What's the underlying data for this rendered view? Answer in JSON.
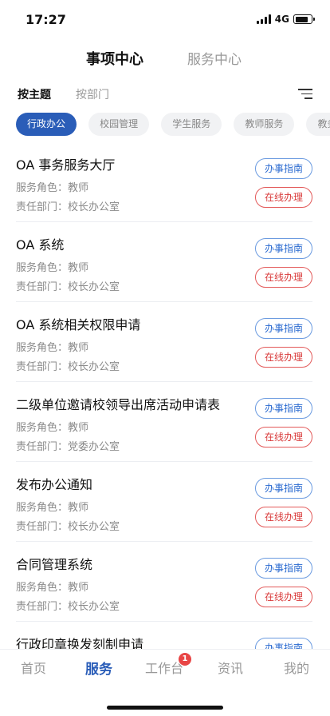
{
  "status_bar": {
    "time": "17:27",
    "network": "4G"
  },
  "top_tabs": {
    "active": "事项中心",
    "inactive": "服务中心"
  },
  "sub_tabs": {
    "active": "按主题",
    "inactive": "按部门"
  },
  "chips": [
    "行政办公",
    "校园管理",
    "学生服务",
    "教师服务",
    "教务"
  ],
  "items": [
    {
      "title": "OA 事务服务大厅",
      "role": "服务角色：教师",
      "dept": "责任部门：校长办公室"
    },
    {
      "title": "OA 系统",
      "role": "服务角色：教师",
      "dept": "责任部门：校长办公室"
    },
    {
      "title": "OA 系统相关权限申请",
      "role": "服务角色：教师",
      "dept": "责任部门：校长办公室"
    },
    {
      "title": "二级单位邀请校领导出席活动申请表",
      "role": "服务角色：教师",
      "dept": "责任部门：党委办公室"
    },
    {
      "title": "发布办公通知",
      "role": "服务角色：教师",
      "dept": "责任部门：校长办公室"
    },
    {
      "title": "合同管理系统",
      "role": "服务角色：教师",
      "dept": "责任部门：校长办公室"
    },
    {
      "title": "行政印章换发刻制申请",
      "role": "",
      "dept": ""
    }
  ],
  "buttons": {
    "guide": "办事指南",
    "online": "在线办理"
  },
  "tab_bar": {
    "home": "首页",
    "service": "服务",
    "workbench": "工作台",
    "workbench_badge": "1",
    "news": "资讯",
    "mine": "我的"
  }
}
